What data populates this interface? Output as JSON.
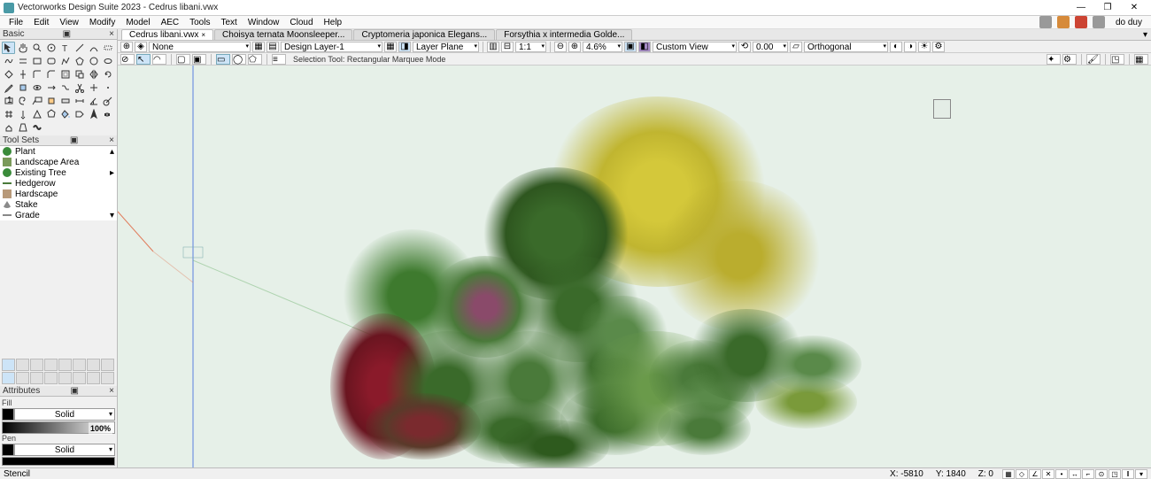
{
  "title": "Vectorworks Design Suite 2023 - Cedrus libani.vwx",
  "win_buttons": {
    "min": "—",
    "max": "❐",
    "close": "✕"
  },
  "user": "do duy",
  "menus": [
    "File",
    "Edit",
    "View",
    "Modify",
    "Model",
    "AEC",
    "Tools",
    "Text",
    "Window",
    "Cloud",
    "Help"
  ],
  "panels": {
    "basic": "Basic",
    "toolsets": "Tool Sets",
    "attributes": "Attributes",
    "stencil": "Stencil"
  },
  "toolsets": [
    {
      "label": "Plant"
    },
    {
      "label": "Landscape Area"
    },
    {
      "label": "Existing Tree"
    },
    {
      "label": "Hedgerow"
    },
    {
      "label": "Hardscape"
    },
    {
      "label": "Stake"
    },
    {
      "label": "Grade"
    }
  ],
  "attrs": {
    "fill": "Fill",
    "pen": "Pen",
    "solid": "Solid",
    "pct": "100%"
  },
  "doc_tabs": [
    {
      "label": "Cedrus libani.vwx",
      "active": true,
      "close": "×"
    },
    {
      "label": "Choisya ternata Moonsleeper...",
      "active": false
    },
    {
      "label": "Cryptomeria japonica Elegans...",
      "active": false
    },
    {
      "label": "Forsythia x intermedia Golde...",
      "active": false
    }
  ],
  "viewbar": {
    "class_sel": "None",
    "layer_sel": "Design Layer-1",
    "plane_sel": "Layer Plane",
    "scale": "1:1",
    "zoom": "4.6%",
    "view": "Custom View",
    "angle": "0.00",
    "proj": "Orthogonal"
  },
  "modebar": {
    "hint": "Selection Tool: Rectangular Marquee Mode"
  },
  "status": {
    "left": "Stencil",
    "x": "X: -5810",
    "y": "Y: 1840",
    "z": "Z: 0"
  },
  "chart_data": null
}
